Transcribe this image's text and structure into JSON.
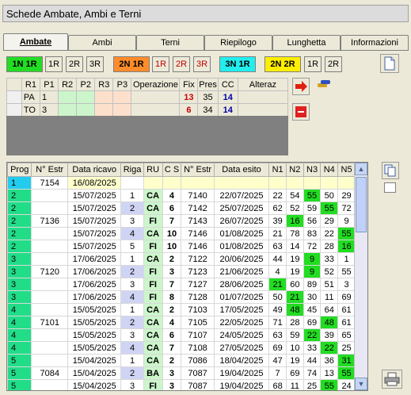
{
  "title": "Schede Ambate, Ambi e Terni",
  "tabs": [
    "Ambate",
    "Ambi",
    "Terni",
    "Riepilogo",
    "Lunghetta",
    "Informazioni"
  ],
  "buttons": [
    {
      "label": "1N 1R",
      "style": "green"
    },
    {
      "label": "1R",
      "style": "plain"
    },
    {
      "label": "2R",
      "style": "plain"
    },
    {
      "label": "3R",
      "style": "plain"
    },
    {
      "label": "2N 1R",
      "style": "orange"
    },
    {
      "label": "1R",
      "style": "plain"
    },
    {
      "label": "2R",
      "style": "plain"
    },
    {
      "label": "3R",
      "style": "plain"
    },
    {
      "label": "3N 1R",
      "style": "cyan"
    },
    {
      "label": "2N 2R",
      "style": "yellow"
    },
    {
      "label": "1R",
      "style": "plain"
    },
    {
      "label": "2R",
      "style": "plain"
    }
  ],
  "params": {
    "headers": [
      "",
      "R1",
      "P1",
      "R2",
      "P2",
      "R3",
      "P3",
      "Operazione",
      "Fix",
      "Pres",
      "CC",
      "Alteraz"
    ],
    "rows": [
      {
        "r1": "PA",
        "p1": "1",
        "fix": "13",
        "pres": "35",
        "cc": "14"
      },
      {
        "r1": "TO",
        "p1": "3",
        "fix": "6",
        "pres": "34",
        "cc": "14"
      }
    ]
  },
  "main": {
    "headers": [
      "Prog",
      "N° Estr",
      "Data ricavo",
      "Riga",
      "RU",
      "C S",
      "N° Estr",
      "Data esito",
      "N1",
      "N2",
      "N3",
      "N4",
      "N5"
    ],
    "rows": [
      {
        "prog": "1",
        "estr": "7154",
        "data": "16/08/2025",
        "riga": "",
        "ru": "",
        "cs": "",
        "estr2": "",
        "esito": "",
        "n": [
          "",
          "",
          "",
          "",
          ""
        ],
        "hl": []
      },
      {
        "prog": "2",
        "estr": "",
        "data": "15/07/2025",
        "riga": "1",
        "ru": "CA",
        "cs": "4",
        "estr2": "7140",
        "esito": "22/07/2025",
        "n": [
          "22",
          "54",
          "55",
          "50",
          "29"
        ],
        "hl": [
          2
        ]
      },
      {
        "prog": "2",
        "estr": "",
        "data": "15/07/2025",
        "riga": "2",
        "ru": "CA",
        "cs": "6",
        "estr2": "7142",
        "esito": "25/07/2025",
        "n": [
          "62",
          "52",
          "59",
          "55",
          "72"
        ],
        "hl": [
          3
        ]
      },
      {
        "prog": "2",
        "estr": "7136",
        "data": "15/07/2025",
        "riga": "3",
        "ru": "FI",
        "cs": "7",
        "estr2": "7143",
        "esito": "26/07/2025",
        "n": [
          "39",
          "16",
          "56",
          "29",
          "9"
        ],
        "hl": [
          1
        ]
      },
      {
        "prog": "2",
        "estr": "",
        "data": "15/07/2025",
        "riga": "4",
        "ru": "CA",
        "cs": "10",
        "estr2": "7146",
        "esito": "01/08/2025",
        "n": [
          "21",
          "78",
          "83",
          "22",
          "55"
        ],
        "hl": [
          4
        ]
      },
      {
        "prog": "2",
        "estr": "",
        "data": "15/07/2025",
        "riga": "5",
        "ru": "FI",
        "cs": "10",
        "estr2": "7146",
        "esito": "01/08/2025",
        "n": [
          "63",
          "14",
          "72",
          "28",
          "16"
        ],
        "hl": [
          4
        ]
      },
      {
        "prog": "3",
        "estr": "",
        "data": "17/06/2025",
        "riga": "1",
        "ru": "CA",
        "cs": "2",
        "estr2": "7122",
        "esito": "20/06/2025",
        "n": [
          "44",
          "19",
          "9",
          "33",
          "1"
        ],
        "hl": [
          2
        ]
      },
      {
        "prog": "3",
        "estr": "7120",
        "data": "17/06/2025",
        "riga": "2",
        "ru": "FI",
        "cs": "3",
        "estr2": "7123",
        "esito": "21/06/2025",
        "n": [
          "4",
          "19",
          "9",
          "52",
          "55"
        ],
        "hl": [
          2
        ]
      },
      {
        "prog": "3",
        "estr": "",
        "data": "17/06/2025",
        "riga": "3",
        "ru": "FI",
        "cs": "7",
        "estr2": "7127",
        "esito": "28/06/2025",
        "n": [
          "21",
          "60",
          "89",
          "51",
          "3"
        ],
        "hl": [
          0
        ]
      },
      {
        "prog": "3",
        "estr": "",
        "data": "17/06/2025",
        "riga": "4",
        "ru": "FI",
        "cs": "8",
        "estr2": "7128",
        "esito": "01/07/2025",
        "n": [
          "50",
          "21",
          "30",
          "11",
          "69"
        ],
        "hl": [
          1
        ]
      },
      {
        "prog": "4",
        "estr": "",
        "data": "15/05/2025",
        "riga": "1",
        "ru": "CA",
        "cs": "2",
        "estr2": "7103",
        "esito": "17/05/2025",
        "n": [
          "49",
          "48",
          "45",
          "64",
          "61"
        ],
        "hl": [
          1
        ]
      },
      {
        "prog": "4",
        "estr": "7101",
        "data": "15/05/2025",
        "riga": "2",
        "ru": "CA",
        "cs": "4",
        "estr2": "7105",
        "esito": "22/05/2025",
        "n": [
          "71",
          "28",
          "69",
          "48",
          "61"
        ],
        "hl": [
          3
        ]
      },
      {
        "prog": "4",
        "estr": "",
        "data": "15/05/2025",
        "riga": "3",
        "ru": "CA",
        "cs": "6",
        "estr2": "7107",
        "esito": "24/05/2025",
        "n": [
          "63",
          "59",
          "22",
          "39",
          "65"
        ],
        "hl": [
          2
        ]
      },
      {
        "prog": "4",
        "estr": "",
        "data": "15/05/2025",
        "riga": "4",
        "ru": "CA",
        "cs": "7",
        "estr2": "7108",
        "esito": "27/05/2025",
        "n": [
          "69",
          "10",
          "33",
          "22",
          "25"
        ],
        "hl": [
          3
        ]
      },
      {
        "prog": "5",
        "estr": "",
        "data": "15/04/2025",
        "riga": "1",
        "ru": "CA",
        "cs": "2",
        "estr2": "7086",
        "esito": "18/04/2025",
        "n": [
          "47",
          "19",
          "44",
          "36",
          "31"
        ],
        "hl": [
          4
        ]
      },
      {
        "prog": "5",
        "estr": "7084",
        "data": "15/04/2025",
        "riga": "2",
        "ru": "BA",
        "cs": "3",
        "estr2": "7087",
        "esito": "19/04/2025",
        "n": [
          "7",
          "69",
          "74",
          "13",
          "55"
        ],
        "hl": [
          4
        ]
      },
      {
        "prog": "5",
        "estr": "",
        "data": "15/04/2025",
        "riga": "3",
        "ru": "FI",
        "cs": "3",
        "estr2": "7087",
        "esito": "19/04/2025",
        "n": [
          "68",
          "11",
          "25",
          "55",
          "24"
        ],
        "hl": [
          3
        ]
      }
    ]
  },
  "icons": {
    "arrow": "right-arrow-icon",
    "cars": "cars-icon",
    "minus": "minus-icon",
    "page": "page-icon",
    "copy": "copy-icon",
    "printer": "printer-icon"
  }
}
